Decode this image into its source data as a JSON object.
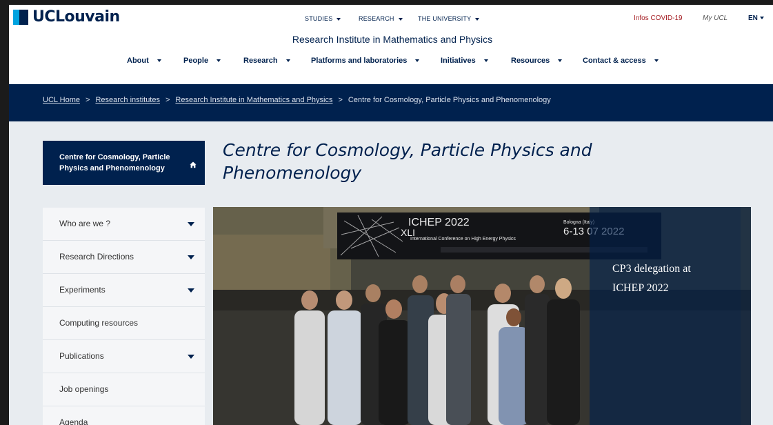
{
  "brand": {
    "name": "UCLouvain"
  },
  "topnav": [
    {
      "label": "STUDIES"
    },
    {
      "label": "RESEARCH"
    },
    {
      "label": "THE UNIVERSITY"
    }
  ],
  "utility": {
    "covid": "Infos COVID-19",
    "myucl": "My UCL",
    "lang": "EN"
  },
  "institute_title": "Research Institute in Mathematics and Physics",
  "mainnav": [
    {
      "label": "About"
    },
    {
      "label": "People"
    },
    {
      "label": "Research"
    },
    {
      "label": "Platforms and laboratories"
    },
    {
      "label": "Initiatives"
    },
    {
      "label": "Resources"
    },
    {
      "label": "Contact & access"
    }
  ],
  "breadcrumb": {
    "items": [
      "UCL Home",
      "Research institutes",
      "Research Institute in Mathematics and Physics",
      "Centre for Cosmology, Particle Physics and Phenomenology"
    ],
    "separator": ">"
  },
  "sidebar": {
    "title": "Centre for Cosmology, Particle Physics and Phenomenology",
    "items": [
      {
        "label": "Who are we ?",
        "has_menu": true
      },
      {
        "label": "Research Directions",
        "has_menu": true
      },
      {
        "label": "Experiments",
        "has_menu": true
      },
      {
        "label": "Computing resources",
        "has_menu": false
      },
      {
        "label": "Publications",
        "has_menu": true
      },
      {
        "label": "Job openings",
        "has_menu": false
      },
      {
        "label": "Agenda",
        "has_menu": false
      }
    ]
  },
  "page_title": "Centre for Cosmology, Particle Physics and Phenomenology",
  "hero": {
    "banner_title": "ICHEP 2022",
    "banner_roman": "XLI",
    "banner_subtitle": "International Conference on High Energy Physics",
    "banner_city": "Bologna (Italy)",
    "banner_dates": "6-13 07 2022",
    "caption": "CP3 delegation at ICHEP 2022"
  },
  "colors": {
    "brand_navy": "#00214e",
    "brand_cyan": "#00a3e0",
    "covid_red": "#a51f24"
  }
}
